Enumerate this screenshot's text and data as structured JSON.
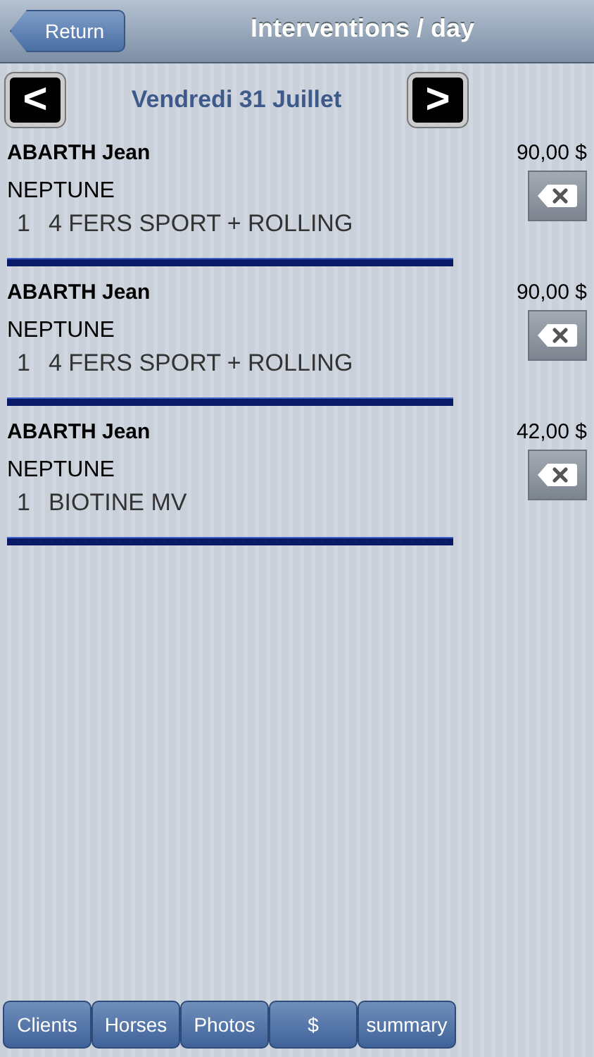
{
  "nav_bar": {
    "back_button": "Return",
    "title": "Interventions / day"
  },
  "date_bar": {
    "prev": "<",
    "date": "Vendredi 31 Juillet",
    "next": ">"
  },
  "interventions": [
    {
      "client": "ABARTH Jean",
      "price": "90,00 $",
      "horse": "NEPTUNE",
      "quantity": "1",
      "product": "4 FERS SPORT + ROLLING"
    },
    {
      "client": "ABARTH Jean",
      "price": "90,00 $",
      "horse": "NEPTUNE",
      "quantity": "1",
      "product": "4 FERS SPORT + ROLLING"
    },
    {
      "client": "ABARTH Jean",
      "price": "42,00 $",
      "horse": "NEPTUNE",
      "quantity": "1",
      "product": "BIOTINE MV"
    }
  ],
  "bottom_buttons": [
    "Clients",
    "Horses",
    "Photos",
    "$",
    "summary"
  ]
}
